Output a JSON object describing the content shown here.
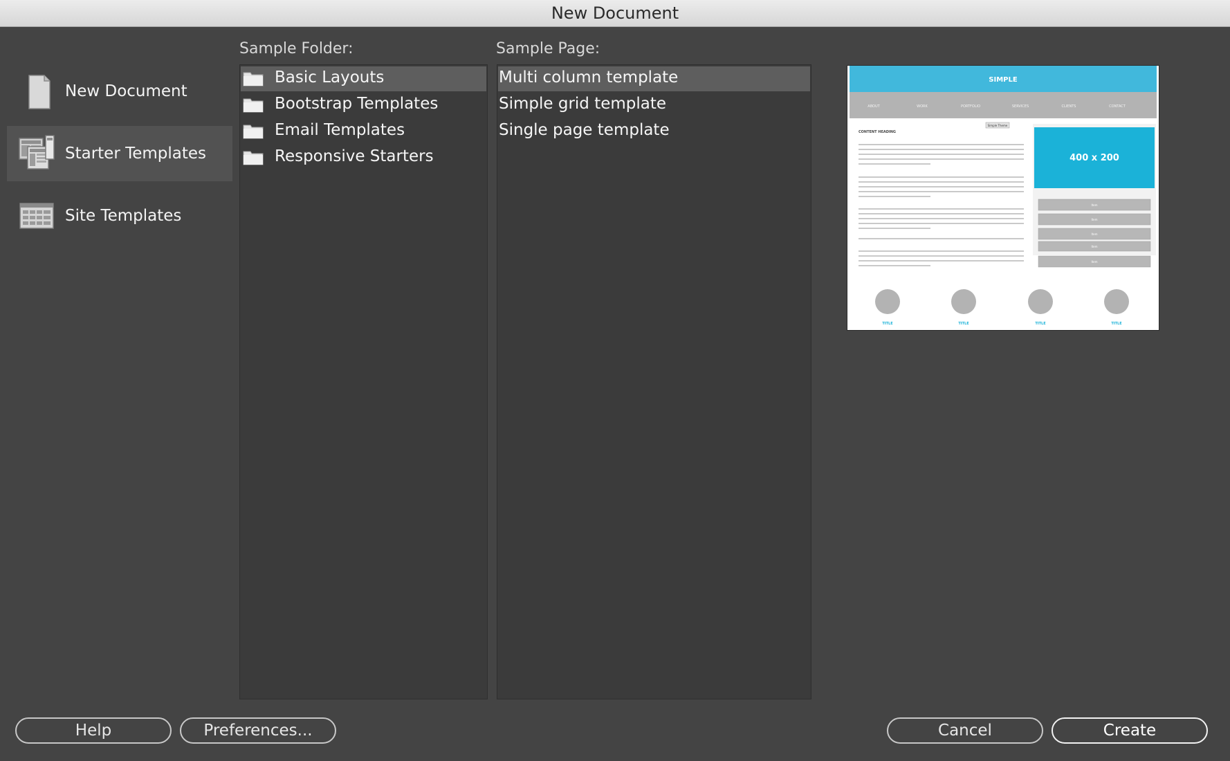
{
  "window": {
    "title": "New Document"
  },
  "sidebar": {
    "items": [
      {
        "label": "New Document",
        "icon": "document-icon"
      },
      {
        "label": "Starter Templates",
        "icon": "starter-templates-icon",
        "selected": true
      },
      {
        "label": "Site Templates",
        "icon": "site-templates-icon"
      }
    ]
  },
  "folders": {
    "header": "Sample Folder:",
    "items": [
      {
        "label": "Basic Layouts",
        "selected": true
      },
      {
        "label": "Bootstrap Templates"
      },
      {
        "label": "Email Templates"
      },
      {
        "label": "Responsive Starters"
      }
    ]
  },
  "pages": {
    "header": "Sample Page:",
    "items": [
      {
        "label": "Multi column template",
        "selected": true
      },
      {
        "label": "Simple grid template"
      },
      {
        "label": "Single page template"
      }
    ]
  },
  "preview": {
    "brand": "SIMPLE",
    "nav": [
      "ABOUT",
      "WORK",
      "PORTFOLIO",
      "SERVICES",
      "CLIENTS",
      "CONTACT"
    ],
    "badge": "Simple Theme",
    "heading": "CONTENT HEADING",
    "placeholder": "400 x 200",
    "links": [
      "Item",
      "Item",
      "Item",
      "Item",
      "Item"
    ],
    "footer_titles": [
      "TITLE",
      "TITLE",
      "TITLE",
      "TITLE"
    ],
    "colors": {
      "accent": "#41b8dc",
      "box": "#1bb2d8",
      "gray": "#b3b3b3"
    }
  },
  "buttons": {
    "help": "Help",
    "preferences": "Preferences...",
    "cancel": "Cancel",
    "create": "Create"
  }
}
